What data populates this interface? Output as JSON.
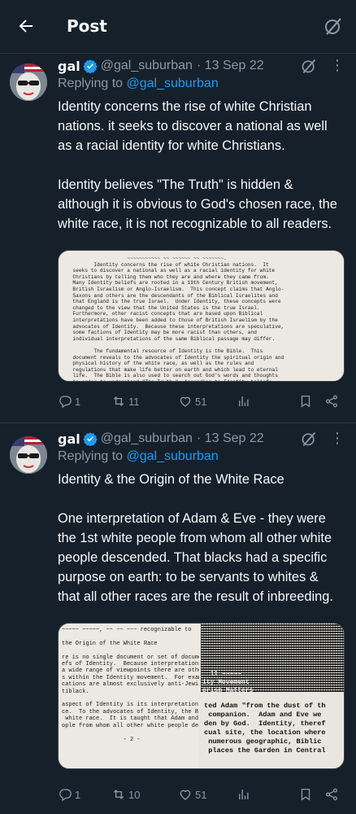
{
  "header": {
    "title": "Post"
  },
  "tweets": [
    {
      "name": "gal",
      "handle": "@gal_suburban",
      "date": "· 13 Sep 22",
      "replying_prefix": "Replying to",
      "replying_to": "@gal_suburban",
      "paragraphs": [
        "Identity concerns the rise of white Christian nations. it seeks to discover a national as well as a racial identity for white Christians.",
        "Identity believes \"The Truth\" is hidden & although it is obvious to God's chosen race, the white race, it is not recognizable to all readers."
      ],
      "media_text": "                    ~~~~~~~~~~~ ~~ ~~~~~~ ~~ ~~~~~~~.\n         Identity concerns the rise of white Christian nations.  It\n  seeks to discover a national as well as a racial identity for white\n  Christians by telling them who they are and where they came from.\n  Many Identity beliefs are rooted in a 19th Century British movement,\n  British Israelism or Anglo-Israelism.  This concept claims that Anglo-\n  Saxons and others are the descendants of the Biblical Israelites and\n  that England is the true Israel.  Under Identity, these concepts were\n  changed to the view that the United States is the true Israel.\n  Furthermore, other racist concepts that are based upon Biblical\n  interpretations have been added to those of British Israelism by the\n  advocates of Identity.  Because these interpretations are speculative,\n  some factions of Identity may be more racist than others, and\n  individual interpretations of the same Biblical passage may differ.\n\n         The fundamental resource of Identity is the Bible.  This\n  document reveals to the advocates of Identity the spiritual origin and\n  physical history of the white race, as well as the rules and\n  regulations that make life better on earth and which lead to eternal\n  life.  The Bible is also used to search out God's words and thoughts\n  in order to understand \"The Truth.\"  According to Identity beliefs,\n  this \"Truth\" is hidden and although it is obvious to those of God's\n  chosen race, the white race, it is not recognizable to all readers.\n  Identity",
      "stats": {
        "replies": "1",
        "reposts": "11",
        "likes": "51",
        "views": ""
      }
    },
    {
      "name": "gal",
      "handle": "@gal_suburban",
      "date": "· 13 Sep 22",
      "replying_prefix": "Replying to",
      "replying_to": "@gal_suburban",
      "paragraphs": [
        "Identity & the Origin of the White Race",
        "One interpretation of Adam & Eve - they were the 1st white people from whom all other white people descended. That blacks had a specific purpose on earth: to be servants to whites & that all other races are the result of inbreeding."
      ],
      "media_left_text": "~~~~~ ~~~~~, ~~ ~~ ~~~ recognizable to\n\nthe Origin of the White Race\n\nre is no single document or set of documen\nefs of Identity.  Because interpretations\na wide range of viewpoints there are othe\ns within the Identity movement.  For exam\ncations are almost exclusively anti-Jewis\ntiblack.\n\naspect of Identity is its interpretation\nce.  To the advocates of Identity, the B\n white race.  It is taught that Adam and\nople from whom all other white people des\n\n                  - 2 -",
      "media_right_mid": "  ll ~~~~~\nity Movement\norism Matters",
      "media_right_text": "ted Adam \"from the dust of th\n companion.  Adam and Eve we\nden by God.  Identity, theref\ncual site, the location where\n numerous geographic, Biblic\n places the Garden in Central",
      "stats": {
        "replies": "1",
        "reposts": "10",
        "likes": "51",
        "views": ""
      }
    }
  ],
  "icons": {
    "back": "arrow-left-icon",
    "grok": "grok-icon",
    "verified": "verified-badge-icon",
    "more": "more-dots-icon",
    "reply": "reply-icon",
    "repost": "repost-icon",
    "like": "heart-icon",
    "views": "views-icon",
    "bookmark": "bookmark-icon",
    "share": "share-icon"
  },
  "colors": {
    "background": "#15202b",
    "text": "#f7f9f9",
    "muted": "#8b98a5",
    "accent": "#1d9bf0",
    "divider": "#2c3640"
  }
}
